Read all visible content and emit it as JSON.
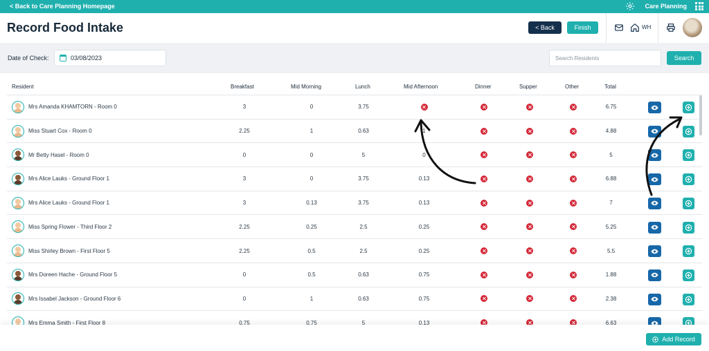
{
  "topbar": {
    "back_link": "< Back to Care Planning Homepage",
    "app_name": "Care Planning",
    "settings_icon": "gear-icon",
    "apps_icon": "grid-icon"
  },
  "header": {
    "title": "Record Food Intake",
    "back_label": "< Back",
    "finish_label": "Finish",
    "location_code": "WH"
  },
  "filters": {
    "date_label": "Date of Check:",
    "date_value": "03/08/2023",
    "search_placeholder": "Search Residents",
    "search_label": "Search"
  },
  "table": {
    "columns": [
      "Resident",
      "Breakfast",
      "Mid Morning",
      "Lunch",
      "Mid Afternoon",
      "Dinner",
      "Supper",
      "Other",
      "Total"
    ],
    "rows": [
      {
        "resident": "Mrs Amanda KHAMTORN - Room 0",
        "breakfast": "3",
        "mid_morning": "0",
        "lunch": "3.75",
        "mid_afternoon": null,
        "total": "6.75",
        "avatar": "light"
      },
      {
        "resident": "Miss Stuart Cox - Room 0",
        "breakfast": "2.25",
        "mid_morning": "1",
        "lunch": "0.63",
        "mid_afternoon": "1",
        "total": "4.88",
        "avatar": "light"
      },
      {
        "resident": "Mr Betty Hasel - Room 0",
        "breakfast": "0",
        "mid_morning": "0",
        "lunch": "5",
        "mid_afternoon": "0",
        "total": "5",
        "avatar": "dark"
      },
      {
        "resident": "Mrs Alice Lauks - Ground Floor 1",
        "breakfast": "3",
        "mid_morning": "0",
        "lunch": "3.75",
        "mid_afternoon": "0.13",
        "total": "6.88",
        "avatar": "dark"
      },
      {
        "resident": "Mrs Alice Lauks - Ground Floor 1",
        "breakfast": "3",
        "mid_morning": "0.13",
        "lunch": "3.75",
        "mid_afternoon": "0.13",
        "total": "7",
        "avatar": "light"
      },
      {
        "resident": "Miss Spring Flower - Third Floor 2",
        "breakfast": "2.25",
        "mid_morning": "0.25",
        "lunch": "2.5",
        "mid_afternoon": "0.25",
        "total": "5.25",
        "avatar": "light"
      },
      {
        "resident": "Miss Shirley Brown - First Floor 5",
        "breakfast": "2.25",
        "mid_morning": "0.5",
        "lunch": "2.5",
        "mid_afternoon": "0.25",
        "total": "5.5",
        "avatar": "light"
      },
      {
        "resident": "Mrs Doreen Hache - Ground Floor 5",
        "breakfast": "0",
        "mid_morning": "0.5",
        "lunch": "0.63",
        "mid_afternoon": "0.75",
        "total": "1.88",
        "avatar": "dark"
      },
      {
        "resident": "Mrs Issabel Jackson - Ground Floor 6",
        "breakfast": "0",
        "mid_morning": "1",
        "lunch": "0.63",
        "mid_afternoon": "0.75",
        "total": "2.38",
        "avatar": "dark"
      },
      {
        "resident": "Mrs Emma Smith - First Floor 8",
        "breakfast": "0.75",
        "mid_morning": "0.75",
        "lunch": "5",
        "mid_afternoon": "0.13",
        "total": "6.63",
        "avatar": "light"
      }
    ]
  },
  "footer": {
    "add_record_label": "Add Record"
  },
  "colors": {
    "teal": "#1fb0ae",
    "navy": "#15304d",
    "view_blue": "#1768a8",
    "missing_red": "#d42837"
  }
}
